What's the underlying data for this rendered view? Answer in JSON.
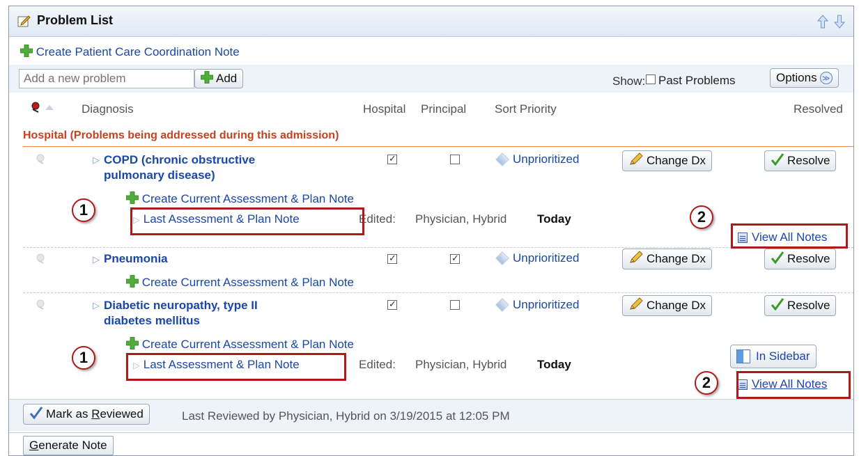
{
  "panel": {
    "title": "Problem List",
    "create_care_note": "Create Patient Care Coordination Note"
  },
  "toolbar": {
    "add_placeholder": "Add a new problem",
    "add_label": "Add",
    "show_label": "Show:",
    "past_problems_label": "Past Problems",
    "past_problems_checked": false,
    "options_label": "Options"
  },
  "columns": {
    "diagnosis": "Diagnosis",
    "hospital": "Hospital",
    "principal": "Principal",
    "sort_priority": "Sort Priority",
    "resolved": "Resolved"
  },
  "section_heading": "Hospital (Problems being addressed during this admission)",
  "problems": [
    {
      "dx_line1": "COPD (chronic obstructive",
      "dx_line2": "pulmonary disease)",
      "hospital": true,
      "principal": false,
      "priority": "Unprioritized",
      "change_label": "Change Dx",
      "resolve_label": "Resolve",
      "create_note": "Create Current Assessment & Plan Note",
      "last_note": "Last Assessment & Plan Note",
      "edited_label": "Edited:",
      "edited_by": "Physician, Hybrid",
      "edited_when": "Today",
      "view_all": "View All Notes"
    },
    {
      "dx_line1": "Pneumonia",
      "hospital": true,
      "principal": true,
      "priority": "Unprioritized",
      "change_label": "Change Dx",
      "resolve_label": "Resolve",
      "create_note": "Create Current Assessment & Plan Note"
    },
    {
      "dx_line1": "Diabetic neuropathy, type II",
      "dx_line2": "diabetes mellitus",
      "hospital": true,
      "principal": false,
      "priority": "Unprioritized",
      "change_label": "Change Dx",
      "resolve_label": "Resolve",
      "create_note": "Create Current Assessment & Plan Note",
      "last_note": "Last Assessment & Plan Note",
      "edited_label": "Edited:",
      "edited_by": "Physician, Hybrid",
      "edited_when": "Today",
      "in_sidebar": "In Sidebar",
      "view_all": "View All Notes"
    }
  ],
  "callouts": {
    "one": "1",
    "two": "2"
  },
  "footer": {
    "mark_reviewed_pre": "Mark as ",
    "mark_reviewed_key": "R",
    "mark_reviewed_post": "eviewed",
    "last_reviewed": "Last Reviewed by Physician, Hybrid on 3/19/2015 at 12:05 PM",
    "generate_key": "G",
    "generate_post": "enerate Note"
  }
}
